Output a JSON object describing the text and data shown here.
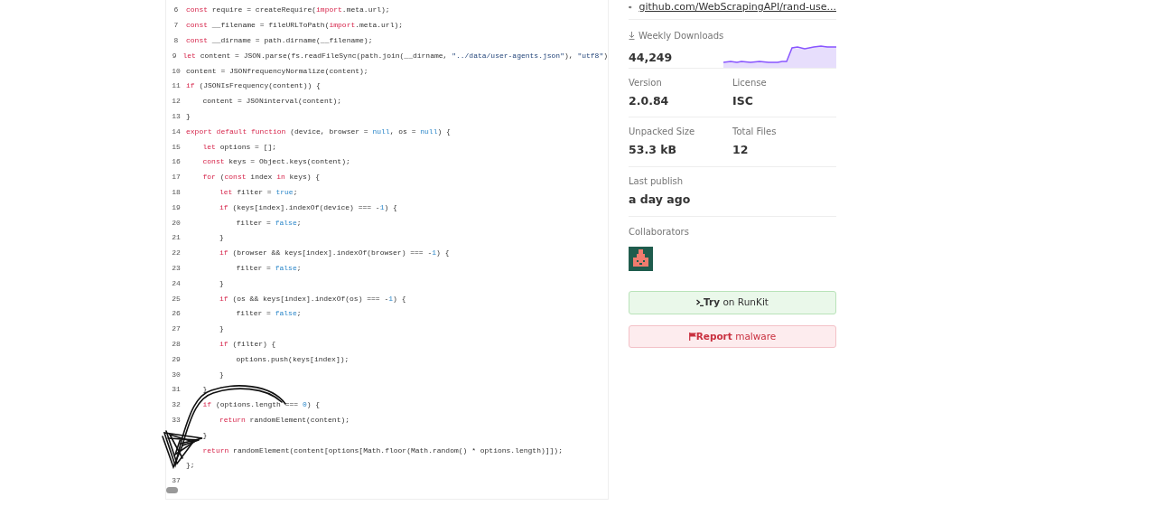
{
  "code_view": {
    "lines": [
      {
        "number": "6",
        "tokens": [
          {
            "kind": "keyword",
            "text": "const"
          },
          {
            "kind": "plain",
            "text": " require = createRequire("
          },
          {
            "kind": "keyword",
            "text": "import"
          },
          {
            "kind": "plain",
            "text": ".meta.url);"
          }
        ]
      },
      {
        "number": "7",
        "tokens": [
          {
            "kind": "keyword",
            "text": "const"
          },
          {
            "kind": "plain",
            "text": " __filename = fileURLToPath("
          },
          {
            "kind": "keyword",
            "text": "import"
          },
          {
            "kind": "plain",
            "text": ".meta.url);"
          }
        ]
      },
      {
        "number": "8",
        "tokens": [
          {
            "kind": "keyword",
            "text": "const"
          },
          {
            "kind": "plain",
            "text": " __dirname = path.dirname(__filename);"
          }
        ]
      },
      {
        "number": "9",
        "tokens": [
          {
            "kind": "keyword",
            "text": "let"
          },
          {
            "kind": "plain",
            "text": " content = JSON.parse(fs.readFileSync(path.join(__dirname, "
          },
          {
            "kind": "string",
            "text": "\"../data/user-agents.json\""
          },
          {
            "kind": "plain",
            "text": "), "
          },
          {
            "kind": "string",
            "text": "\"utf8\""
          },
          {
            "kind": "plain",
            "text": ")"
          }
        ]
      },
      {
        "number": "10",
        "tokens": [
          {
            "kind": "plain",
            "text": "content = JSONfrequencyNormalize(content);"
          }
        ]
      },
      {
        "number": "11",
        "tokens": [
          {
            "kind": "keyword",
            "text": "if"
          },
          {
            "kind": "plain",
            "text": " (JSONIsFrequency(content)) {"
          }
        ],
        "children": [
          {
            "number": "12",
            "tokens": [
              {
                "kind": "plain",
                "text": "content = JSONinterval(content);"
              }
            ]
          }
        ]
      },
      {
        "number": "13",
        "tokens": [
          {
            "kind": "plain",
            "text": "}"
          }
        ]
      },
      {
        "number": "14",
        "tokens": [
          {
            "kind": "keyword",
            "text": "export default function"
          },
          {
            "kind": "plain",
            "text": " (device, browser = "
          },
          {
            "kind": "literal",
            "text": "null"
          },
          {
            "kind": "plain",
            "text": ", os = "
          },
          {
            "kind": "literal",
            "text": "null"
          },
          {
            "kind": "plain",
            "text": ") {"
          }
        ],
        "children": [
          {
            "number": "15",
            "tokens": [
              {
                "kind": "keyword",
                "text": "let"
              },
              {
                "kind": "plain",
                "text": " options = [];"
              }
            ]
          },
          {
            "number": "16",
            "tokens": [
              {
                "kind": "keyword",
                "text": "const"
              },
              {
                "kind": "plain",
                "text": " keys = Object.keys(content);"
              }
            ]
          },
          {
            "number": "17",
            "tokens": [
              {
                "kind": "keyword",
                "text": "for"
              },
              {
                "kind": "plain",
                "text": " ("
              },
              {
                "kind": "keyword",
                "text": "const"
              },
              {
                "kind": "plain",
                "text": " index "
              },
              {
                "kind": "keyword",
                "text": "in"
              },
              {
                "kind": "plain",
                "text": " keys) {"
              }
            ],
            "children": [
              {
                "number": "18",
                "tokens": [
                  {
                    "kind": "keyword",
                    "text": "let"
                  },
                  {
                    "kind": "plain",
                    "text": " filter = "
                  },
                  {
                    "kind": "literal",
                    "text": "true"
                  },
                  {
                    "kind": "plain",
                    "text": ";"
                  }
                ]
              },
              {
                "number": "19",
                "tokens": [
                  {
                    "kind": "keyword",
                    "text": "if"
                  },
                  {
                    "kind": "plain",
                    "text": " (keys[index].indexOf(device) === -"
                  },
                  {
                    "kind": "literal",
                    "text": "1"
                  },
                  {
                    "kind": "plain",
                    "text": ") {"
                  }
                ],
                "children": [
                  {
                    "number": "20",
                    "tokens": [
                      {
                        "kind": "plain",
                        "text": "filter = "
                      },
                      {
                        "kind": "literal",
                        "text": "false"
                      },
                      {
                        "kind": "plain",
                        "text": ";"
                      }
                    ]
                  }
                ]
              },
              {
                "number": "21",
                "tokens": [
                  {
                    "kind": "plain",
                    "text": "}"
                  }
                ]
              },
              {
                "number": "22",
                "tokens": [
                  {
                    "kind": "keyword",
                    "text": "if"
                  },
                  {
                    "kind": "plain",
                    "text": " (browser && keys[index].indexOf(browser) === -"
                  },
                  {
                    "kind": "literal",
                    "text": "1"
                  },
                  {
                    "kind": "plain",
                    "text": ") {"
                  }
                ],
                "children": [
                  {
                    "number": "23",
                    "tokens": [
                      {
                        "kind": "plain",
                        "text": "filter = "
                      },
                      {
                        "kind": "literal",
                        "text": "false"
                      },
                      {
                        "kind": "plain",
                        "text": ";"
                      }
                    ]
                  }
                ]
              },
              {
                "number": "24",
                "tokens": [
                  {
                    "kind": "plain",
                    "text": "}"
                  }
                ]
              },
              {
                "number": "25",
                "tokens": [
                  {
                    "kind": "keyword",
                    "text": "if"
                  },
                  {
                    "kind": "plain",
                    "text": " (os && keys[index].indexOf(os) === -"
                  },
                  {
                    "kind": "literal",
                    "text": "1"
                  },
                  {
                    "kind": "plain",
                    "text": ") {"
                  }
                ],
                "children": [
                  {
                    "number": "26",
                    "tokens": [
                      {
                        "kind": "plain",
                        "text": "filter = "
                      },
                      {
                        "kind": "literal",
                        "text": "false"
                      },
                      {
                        "kind": "plain",
                        "text": ";"
                      }
                    ]
                  }
                ]
              },
              {
                "number": "27",
                "tokens": [
                  {
                    "kind": "plain",
                    "text": "}"
                  }
                ]
              },
              {
                "number": "28",
                "tokens": [
                  {
                    "kind": "keyword",
                    "text": "if"
                  },
                  {
                    "kind": "plain",
                    "text": " (filter) {"
                  }
                ],
                "children": [
                  {
                    "number": "29",
                    "tokens": [
                      {
                        "kind": "plain",
                        "text": "options.push(keys[index]);"
                      }
                    ]
                  }
                ]
              },
              {
                "number": "30",
                "tokens": [
                  {
                    "kind": "plain",
                    "text": "}"
                  }
                ]
              }
            ]
          },
          {
            "number": "31",
            "tokens": [
              {
                "kind": "plain",
                "text": "}"
              }
            ]
          },
          {
            "number": "32",
            "tokens": [
              {
                "kind": "keyword",
                "text": "if"
              },
              {
                "kind": "plain",
                "text": " (options.length === "
              },
              {
                "kind": "literal",
                "text": "0"
              },
              {
                "kind": "plain",
                "text": ") {"
              }
            ],
            "children": [
              {
                "number": "33",
                "tokens": [
                  {
                    "kind": "keyword",
                    "text": "return"
                  },
                  {
                    "kind": "plain",
                    "text": " randomElement(content);"
                  }
                ]
              }
            ]
          },
          {
            "tokens": [
              {
                "kind": "plain",
                "text": "}"
              }
            ]
          },
          {
            "tokens": [
              {
                "kind": "keyword",
                "text": "return"
              },
              {
                "kind": "plain",
                "text": " randomElement(content[options[Math.floor(Math.random() * options.length)]]);"
              }
            ]
          }
        ]
      },
      {
        "tokens": [
          {
            "kind": "plain",
            "text": "};"
          }
        ]
      },
      {
        "number": "37"
      }
    ]
  },
  "sidebar": {
    "repository_link": "github.com/WebScrapingAPI/rand-use...",
    "weekly_downloads": {
      "label": "Weekly Downloads",
      "value": "44,249"
    },
    "stats": [
      [
        {
          "label": "Version",
          "value": "2.0.84"
        },
        {
          "label": "License",
          "value": "ISC"
        }
      ],
      [
        {
          "label": "Unpacked Size",
          "value": "53.3 kB"
        },
        {
          "label": "Total Files",
          "value": "12"
        }
      ],
      [
        {
          "label": "Last publish",
          "value": "a day ago"
        }
      ]
    ],
    "collaborators_label": "Collaborators",
    "buttons": [
      {
        "kind": "try",
        "text": "**Try** on RunKit"
      },
      {
        "kind": "report",
        "text": "**Report** malware"
      }
    ]
  }
}
